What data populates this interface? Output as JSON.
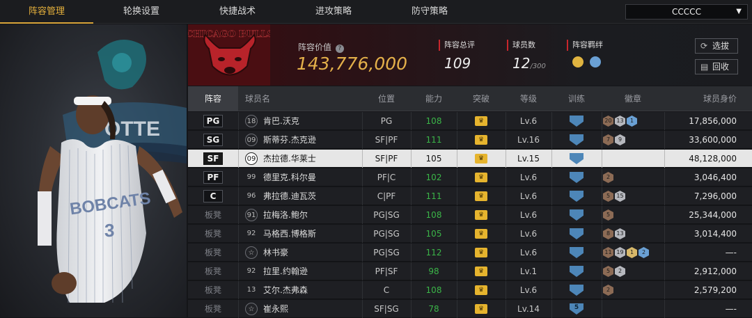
{
  "nav": {
    "tabs": [
      "阵容管理",
      "轮换设置",
      "快捷战术",
      "进攻策略",
      "防守策略"
    ],
    "active_index": 0,
    "team_select": "CCCCC"
  },
  "summary": {
    "team_logo_text": "CHICAGO BULLS",
    "value_label": "阵容价值",
    "value": "143,776,000",
    "overall_label": "阵容总评",
    "overall": "109",
    "players_label": "球员数",
    "players_count": "12",
    "players_max": "/300",
    "bond_label": "阵容羁绊",
    "select_btn": "选拔",
    "recycle_btn": "回收"
  },
  "table": {
    "headers": [
      "阵容",
      "球员名",
      "位置",
      "能力",
      "突破",
      "等级",
      "训练",
      "徽章",
      "球员身价"
    ],
    "rows": [
      {
        "slot": "PG",
        "starter": true,
        "jersey": "18",
        "jersey_circle": true,
        "name": "肯巴.沃克",
        "position": "PG",
        "ovr": "108",
        "ovr_green": true,
        "level": "Lv.6",
        "train": "",
        "badges": [
          {
            "t": "20",
            "c": "bronze"
          },
          {
            "t": "13",
            "c": "silver"
          },
          {
            "t": "1",
            "c": "blue"
          }
        ],
        "value": "17,856,000",
        "selected": false
      },
      {
        "slot": "SG",
        "starter": true,
        "jersey": "09",
        "jersey_circle": true,
        "name": "斯蒂芬.杰克逊",
        "position": "SF|PF",
        "ovr": "111",
        "ovr_green": true,
        "level": "Lv.16",
        "train": "",
        "badges": [
          {
            "t": "7",
            "c": "bronze"
          },
          {
            "t": "9",
            "c": "silver"
          }
        ],
        "value": "33,600,000",
        "selected": false
      },
      {
        "slot": "SF",
        "starter": true,
        "jersey": "09",
        "jersey_circle": true,
        "name": "杰拉德.华莱士",
        "position": "SF|PF",
        "ovr": "105",
        "ovr_green": false,
        "level": "Lv.15",
        "train": "",
        "badges": [],
        "value": "48,128,000",
        "selected": true
      },
      {
        "slot": "PF",
        "starter": true,
        "jersey": "99",
        "jersey_circle": false,
        "name": "德里克.科尔曼",
        "position": "PF|C",
        "ovr": "102",
        "ovr_green": true,
        "level": "Lv.6",
        "train": "",
        "badges": [
          {
            "t": "2",
            "c": "bronze"
          }
        ],
        "value": "3,046,400",
        "selected": false
      },
      {
        "slot": "C",
        "starter": true,
        "jersey": "96",
        "jersey_circle": false,
        "name": "弗拉德.迪瓦茨",
        "position": "C|PF",
        "ovr": "111",
        "ovr_green": true,
        "level": "Lv.6",
        "train": "",
        "badges": [
          {
            "t": "5",
            "c": "bronze"
          },
          {
            "t": "15",
            "c": "silver"
          }
        ],
        "value": "7,296,000",
        "selected": false
      },
      {
        "slot": "板凳",
        "starter": false,
        "jersey": "91",
        "jersey_circle": true,
        "name": "拉梅洛.鲍尔",
        "position": "PG|SG",
        "ovr": "108",
        "ovr_green": true,
        "level": "Lv.6",
        "train": "",
        "badges": [
          {
            "t": "5",
            "c": "bronze"
          }
        ],
        "value": "25,344,000",
        "selected": false
      },
      {
        "slot": "板凳",
        "starter": false,
        "jersey": "92",
        "jersey_circle": false,
        "name": "马格西.博格斯",
        "position": "PG|SG",
        "ovr": "105",
        "ovr_green": true,
        "level": "Lv.6",
        "train": "",
        "badges": [
          {
            "t": "8",
            "c": "bronze"
          },
          {
            "t": "13",
            "c": "silver"
          }
        ],
        "value": "3,014,400",
        "selected": false
      },
      {
        "slot": "板凳",
        "starter": false,
        "jersey": "☆",
        "jersey_circle": true,
        "name": "林书豪",
        "position": "PG|SG",
        "ovr": "112",
        "ovr_green": true,
        "level": "Lv.6",
        "train": "",
        "badges": [
          {
            "t": "11",
            "c": "bronze"
          },
          {
            "t": "19",
            "c": "silver"
          },
          {
            "t": "1",
            "c": "gold"
          },
          {
            "t": "2",
            "c": "blue"
          }
        ],
        "value": "—-",
        "selected": false
      },
      {
        "slot": "板凳",
        "starter": false,
        "jersey": "92",
        "jersey_circle": false,
        "name": "拉里.约翰逊",
        "position": "PF|SF",
        "ovr": "98",
        "ovr_green": true,
        "level": "Lv.1",
        "train": "",
        "badges": [
          {
            "t": "5",
            "c": "bronze"
          },
          {
            "t": "2",
            "c": "silver"
          }
        ],
        "value": "2,912,000",
        "selected": false
      },
      {
        "slot": "板凳",
        "starter": false,
        "jersey": "13",
        "jersey_circle": false,
        "name": "艾尔.杰弗森",
        "position": "C",
        "ovr": "108",
        "ovr_green": true,
        "level": "Lv.6",
        "train": "",
        "badges": [
          {
            "t": "2",
            "c": "bronze"
          }
        ],
        "value": "2,579,200",
        "selected": false
      },
      {
        "slot": "板凳",
        "starter": false,
        "jersey": "☆",
        "jersey_circle": true,
        "name": "崔永熙",
        "position": "SF|SG",
        "ovr": "78",
        "ovr_green": true,
        "level": "Lv.14",
        "train": "5",
        "badges": [],
        "value": "—-",
        "selected": false
      }
    ]
  },
  "left": {
    "jersey_text": "BOBCATS",
    "jersey_number": "3",
    "bg_text": "OTTE"
  },
  "colors": {
    "accent_gold": "#e6b13c",
    "red": "#c8262c",
    "green": "#3bb548",
    "crown": "#e6b42e",
    "shield": "#4d86b8"
  }
}
